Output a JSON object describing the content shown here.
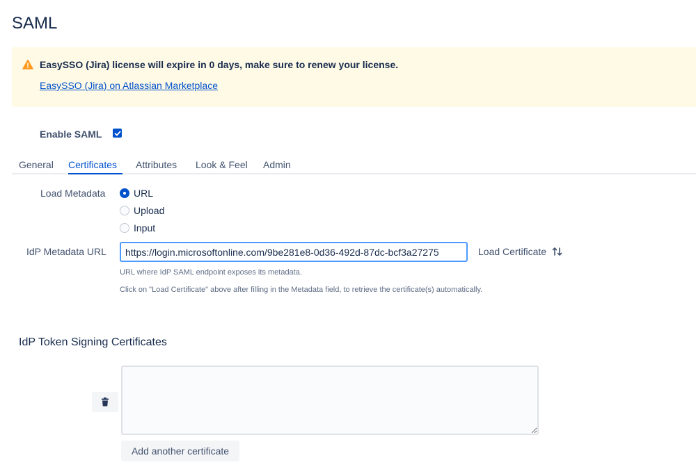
{
  "page": {
    "title": "SAML"
  },
  "banner": {
    "icon": "warning-icon",
    "message": "EasySSO (Jira) license will expire in 0 days, make sure to renew your license.",
    "link_text": "EasySSO (Jira) on Atlassian Marketplace",
    "colors": {
      "background": "#fffae6",
      "icon": "#ff991f",
      "link": "#0052cc"
    }
  },
  "enable_saml": {
    "label": "Enable SAML",
    "checked": true
  },
  "tabs": [
    {
      "label": "General",
      "active": false
    },
    {
      "label": "Certificates",
      "active": true
    },
    {
      "label": "Attributes",
      "active": false
    },
    {
      "label": "Look & Feel",
      "active": false
    },
    {
      "label": "Admin",
      "active": false
    }
  ],
  "load_metadata": {
    "label": "Load Metadata",
    "options": [
      {
        "label": "URL",
        "selected": true
      },
      {
        "label": "Upload",
        "selected": false
      },
      {
        "label": "Input",
        "selected": false
      }
    ]
  },
  "idp_metadata_url": {
    "label": "IdP Metadata URL",
    "value": "https://login.microsoftonline.com/9be281e8-0d36-492d-87dc-bcf3a27275",
    "load_button_label": "Load Certificate",
    "load_button_icon": "sort-arrows-icon",
    "help_1": "URL where IdP SAML endpoint exposes its metadata.",
    "help_2": "Click on \"Load Certificate\" above after filling in the Metadata field, to retrieve the certificate(s) automatically."
  },
  "certificates": {
    "section_title": "IdP Token Signing Certificates",
    "delete_icon": "trash-icon",
    "textarea_value": "",
    "add_button_label": "Add another certificate"
  },
  "accent_color": "#0052cc"
}
